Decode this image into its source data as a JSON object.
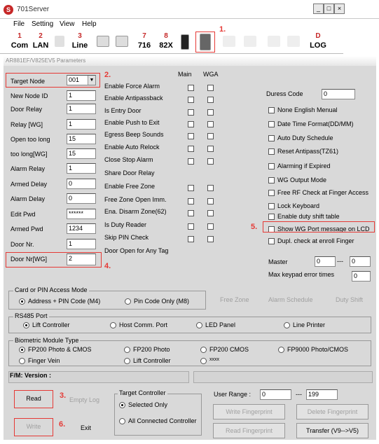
{
  "window": {
    "title": "701Server",
    "logo": "S"
  },
  "menu": [
    "File",
    "Setting",
    "View",
    "Help"
  ],
  "toolbar": {
    "com_label": "Com",
    "com_num": "1",
    "lan_label": "LAN",
    "lan_num": "2",
    "line_label": "Line",
    "line_num": "3",
    "btn716_label": "716",
    "btn716_num": "7",
    "btn82x_label": "82X",
    "btn82x_num": "8",
    "log_label": "LOG",
    "log_num": "D"
  },
  "panel": {
    "title": "AR881EF/V825EV5 Parameters"
  },
  "markers": {
    "m1": "1.",
    "m2": "2.",
    "m3": "3.",
    "m4": "4.",
    "m5": "5.",
    "m6": "6."
  },
  "fields": {
    "target_node": {
      "label": "Target Node",
      "value": "001"
    },
    "new_node_id": {
      "label": "New Node ID",
      "value": "1"
    },
    "door_relay": {
      "label": "Door Relay",
      "value": "1"
    },
    "relay_wg": {
      "label": "Relay [WG]",
      "value": "1"
    },
    "open_too_long": {
      "label": "Open too long",
      "value": "15"
    },
    "too_long_wg": {
      "label": "too long[WG]",
      "value": "15"
    },
    "alarm_relay": {
      "label": "Alarm Relay",
      "value": "1"
    },
    "armed_delay": {
      "label": "Armed Delay",
      "value": "0"
    },
    "alarm_delay": {
      "label": "Alarm Delay",
      "value": "0"
    },
    "edit_pwd": {
      "label": "Edit Pwd",
      "value": "******"
    },
    "armed_pwd": {
      "label": "Armed Pwd",
      "value": "1234"
    },
    "door_nr": {
      "label": "Door Nr.",
      "value": "1"
    },
    "door_nr_wg": {
      "label": "Door Nr[WG]",
      "value": "2"
    }
  },
  "col_headers": {
    "main": "Main",
    "wga": "WGA"
  },
  "options": [
    {
      "label": "Enable Force Alarm",
      "main": false,
      "wga": false
    },
    {
      "label": "Enable Antipassback",
      "main": false,
      "wga": false
    },
    {
      "label": "Is Entry Door",
      "main": false,
      "wga": false
    },
    {
      "label": "Enable Push to Exit",
      "main": false,
      "wga": false
    },
    {
      "label": "Egress Beep Sounds",
      "main": false,
      "wga": false
    },
    {
      "label": "Enable Auto Relock",
      "main": false,
      "wga": false
    },
    {
      "label": "Close Stop Alarm",
      "main": false,
      "wga": false
    },
    {
      "label": "Share Door Relay",
      "main": false,
      "wga": false
    },
    {
      "label": "Enable Free Zone",
      "main": false,
      "wga": false
    },
    {
      "label": "Free Zone Open Imm.",
      "main": false,
      "wga": false
    },
    {
      "label": "Ena. Disarm Zone(62)",
      "main": false,
      "wga": false
    },
    {
      "label": "Is Duty Reader",
      "main": false,
      "wga": false
    },
    {
      "label": "Skip PIN Check",
      "main": false,
      "wga": false
    },
    {
      "label": "Door Open for Any Tag",
      "main": false,
      "wga": false
    }
  ],
  "duress": {
    "label": "Duress Code",
    "value": "0"
  },
  "right_options": [
    "None English Menual",
    "Date Time Format(DD/MM)",
    "Auto Duty Schedule",
    "Reset Antipass(TZ61)",
    "Alarming if Expired",
    "WG Output Mode",
    "Free RF Check at Finger Access",
    "Lock Keyboard",
    "Enable duty shift table",
    "Show WG Port message on LCD",
    "Dupl. check at enroll  Finger"
  ],
  "master": {
    "label": "Master",
    "value1": "0",
    "sep": "---",
    "value2": "0"
  },
  "max_keypad": {
    "label": "Max keypad error times",
    "value": "0"
  },
  "card_mode": {
    "title": "Card or PIN Access Mode",
    "opt1": "Address + PIN Code (M4)",
    "opt2": "Pin Code Only (M8)"
  },
  "gray_links": {
    "free_zone": "Free Zone",
    "alarm_schedule": "Alarm Schedule",
    "duty_shift": "Duty Shift"
  },
  "rs485": {
    "title": "RS485 Port",
    "opts": [
      "Lift Controller",
      "Host Comm. Port",
      "LED Panel",
      "Line Printer"
    ]
  },
  "bio": {
    "title": "Biometric Module Type",
    "opts": [
      "FP200 Photo & CMOS",
      "FP200 Photo",
      "FP200 CMOS",
      "FP9000 Photo/CMOS",
      "Finger Vein",
      "Lift Controller",
      "xxxx"
    ]
  },
  "fm_version": "F/M:  Version :",
  "bottom": {
    "read": "Read",
    "empty_log": "Empty Log",
    "write": "Write",
    "exit": "Exit",
    "target_controller": "Target Controller",
    "selected_only": "Selected Only",
    "all_connected": "All Connected Controller",
    "user_range": "User Range :",
    "range_from": "0",
    "range_sep": "---",
    "range_to": "199",
    "write_fp": "Write Fingerprint",
    "delete_fp": "Delete Fingerprint",
    "read_fp": "Read Fingerprint",
    "transfer": "Transfer (V9-->V5)"
  }
}
